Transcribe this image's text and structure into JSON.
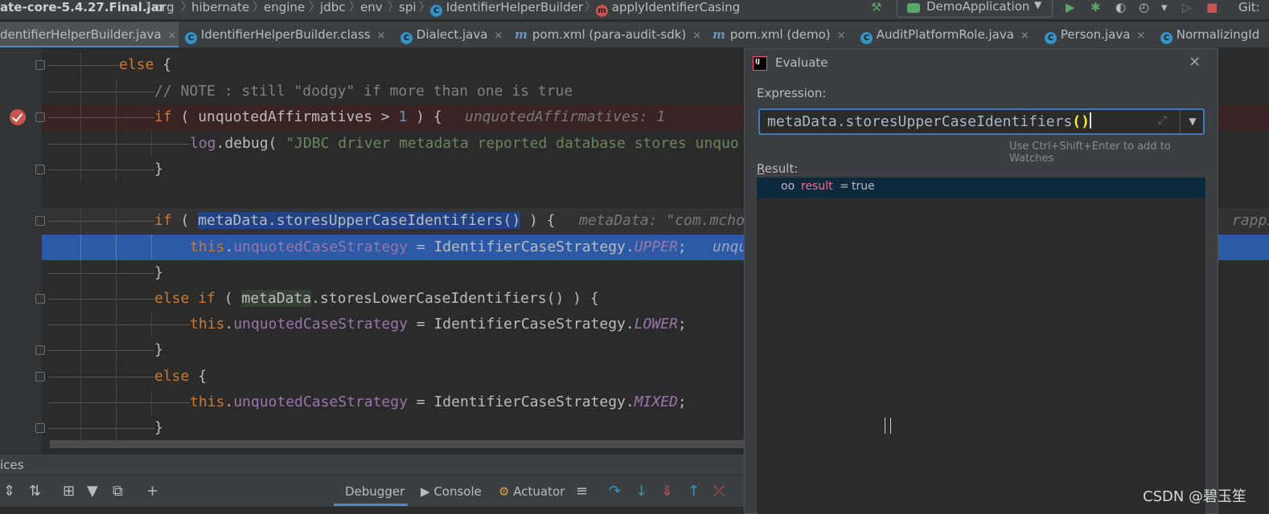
{
  "breadcrumb": {
    "items": [
      "ate-core-5.4.27.Final.jar",
      "org",
      "hibernate",
      "engine",
      "jdbc",
      "env",
      "spi",
      "IdentifierHelperBuilder",
      "applyIdentifierCasing"
    ],
    "class_icon": "C",
    "method_icon": "m"
  },
  "toolbar": {
    "run_config": "DemoApplication",
    "git_label": "Git:"
  },
  "tabs": [
    {
      "label": "dentifierHelperBuilder.java",
      "icon": "none",
      "active": true
    },
    {
      "label": "IdentifierHelperBuilder.class",
      "icon": "class-icon"
    },
    {
      "label": "Dialect.java",
      "icon": "class-icon"
    },
    {
      "label": "pom.xml (para-audit-sdk)",
      "icon": "maven-icon"
    },
    {
      "label": "pom.xml (demo)",
      "icon": "maven-icon"
    },
    {
      "label": "AuditPlatformRole.java",
      "icon": "class-icon"
    },
    {
      "label": "Person.java",
      "icon": "class-icon"
    },
    {
      "label": "NormalizingId",
      "icon": "class-icon"
    }
  ],
  "tab_glyphs": {
    "close": "×",
    "class": "C",
    "maven": "m"
  },
  "editor": {
    "lines": {
      "l1_else": "else",
      "l1_brace": "{",
      "l2_comment": "// NOTE : still \"dodgy\" if more than one is true",
      "l3_if": "if",
      "l3_open": "( ",
      "l3_var": "unquotedAffirmatives",
      "l3_op": " > ",
      "l3_num": "1",
      "l3_close": " ) {",
      "l3_inline": "unquotedAffirmatives: 1",
      "l4_log": "log",
      "l4_call": ".debug( ",
      "l4_str": "\"JDBC driver metadata reported database stores unquo",
      "l5_brace": "}",
      "l7_if": "if",
      "l7_open": " ( ",
      "l7_sel": "metaData.storesUpperCaseIdentifiers()",
      "l7_close": " ) {",
      "l7_inline": "metaData: \"com.mcho",
      "l7_inline_right": "rappin",
      "l8_this": "this",
      "l8_dot": ".",
      "l8_field": "unquotedCaseStrategy",
      "l8_eq": " = IdentifierCaseStrategy.",
      "l8_const": "UPPER",
      "l8_semi": ";",
      "l8_inline": "unqu",
      "l9_brace": "}",
      "l10_else": "else if",
      "l10_open": " ( ",
      "l10_hl": "metaData",
      "l10_rest": ".storesLowerCaseIdentifiers() ) {",
      "l11_this": "this",
      "l11_dot": ".",
      "l11_field": "unquotedCaseStrategy",
      "l11_eq": " = IdentifierCaseStrategy.",
      "l11_const": "LOWER",
      "l11_semi": ";",
      "l12_brace": "}",
      "l13_else": "else",
      "l13_brace": " {",
      "l14_this": "this",
      "l14_dot": ".",
      "l14_field": "unquotedCaseStrategy",
      "l14_eq": " = IdentifierCaseStrategy.",
      "l14_const": "MIXED",
      "l14_semi": ";",
      "l15_brace": "}"
    }
  },
  "evaluate_dialog": {
    "title": "Evaluate",
    "close": "✕",
    "expression_label": "Expression:",
    "expression_text": "metaData.storesUpperCaseIdentifiers",
    "expression_parens": "()",
    "expand_glyph": "⤢",
    "dropdown_glyph": "▼",
    "watch_hint": "Use Ctrl+Shift+Enter to add to Watches",
    "result_label_first": "R",
    "result_label_rest": "esult:",
    "result_glasses": "oo",
    "result_name": "result",
    "result_eq": "=",
    "result_value": "true"
  },
  "debug_panel": {
    "services_label": "ices",
    "tab_debugger": "Debugger",
    "tab_console": "Console",
    "tab_actuator": "Actuator",
    "glyphs": {
      "expand": "⇕",
      "collapse": "⇅",
      "group": "⊞",
      "filter": "▼",
      "new_window": "⧉",
      "add": "+",
      "console": "▶",
      "actuator": "⚙",
      "menu": "≡",
      "step_over": "↷",
      "step_into": "↓",
      "force_step": "⇓",
      "step_out": "↑",
      "drop_frame": "⤫"
    }
  },
  "run_glyphs": {
    "build": "⚒",
    "caret": "▼",
    "run": "▶",
    "debug": "✱",
    "coverage": "◐",
    "profile": "◴",
    "more": "▾",
    "resume": "▷",
    "stop": "■"
  },
  "watermark": "CSDN @碧玉笙",
  "colors": {
    "editor_bg": "#2b2b2b",
    "panel_bg": "#3c3f41",
    "exec_line": "#2d5aa6",
    "breakpoint": "#c75450",
    "keyword": "#cc7832",
    "field": "#9876aa",
    "string": "#6a8759",
    "accent": "#4a88c7"
  }
}
